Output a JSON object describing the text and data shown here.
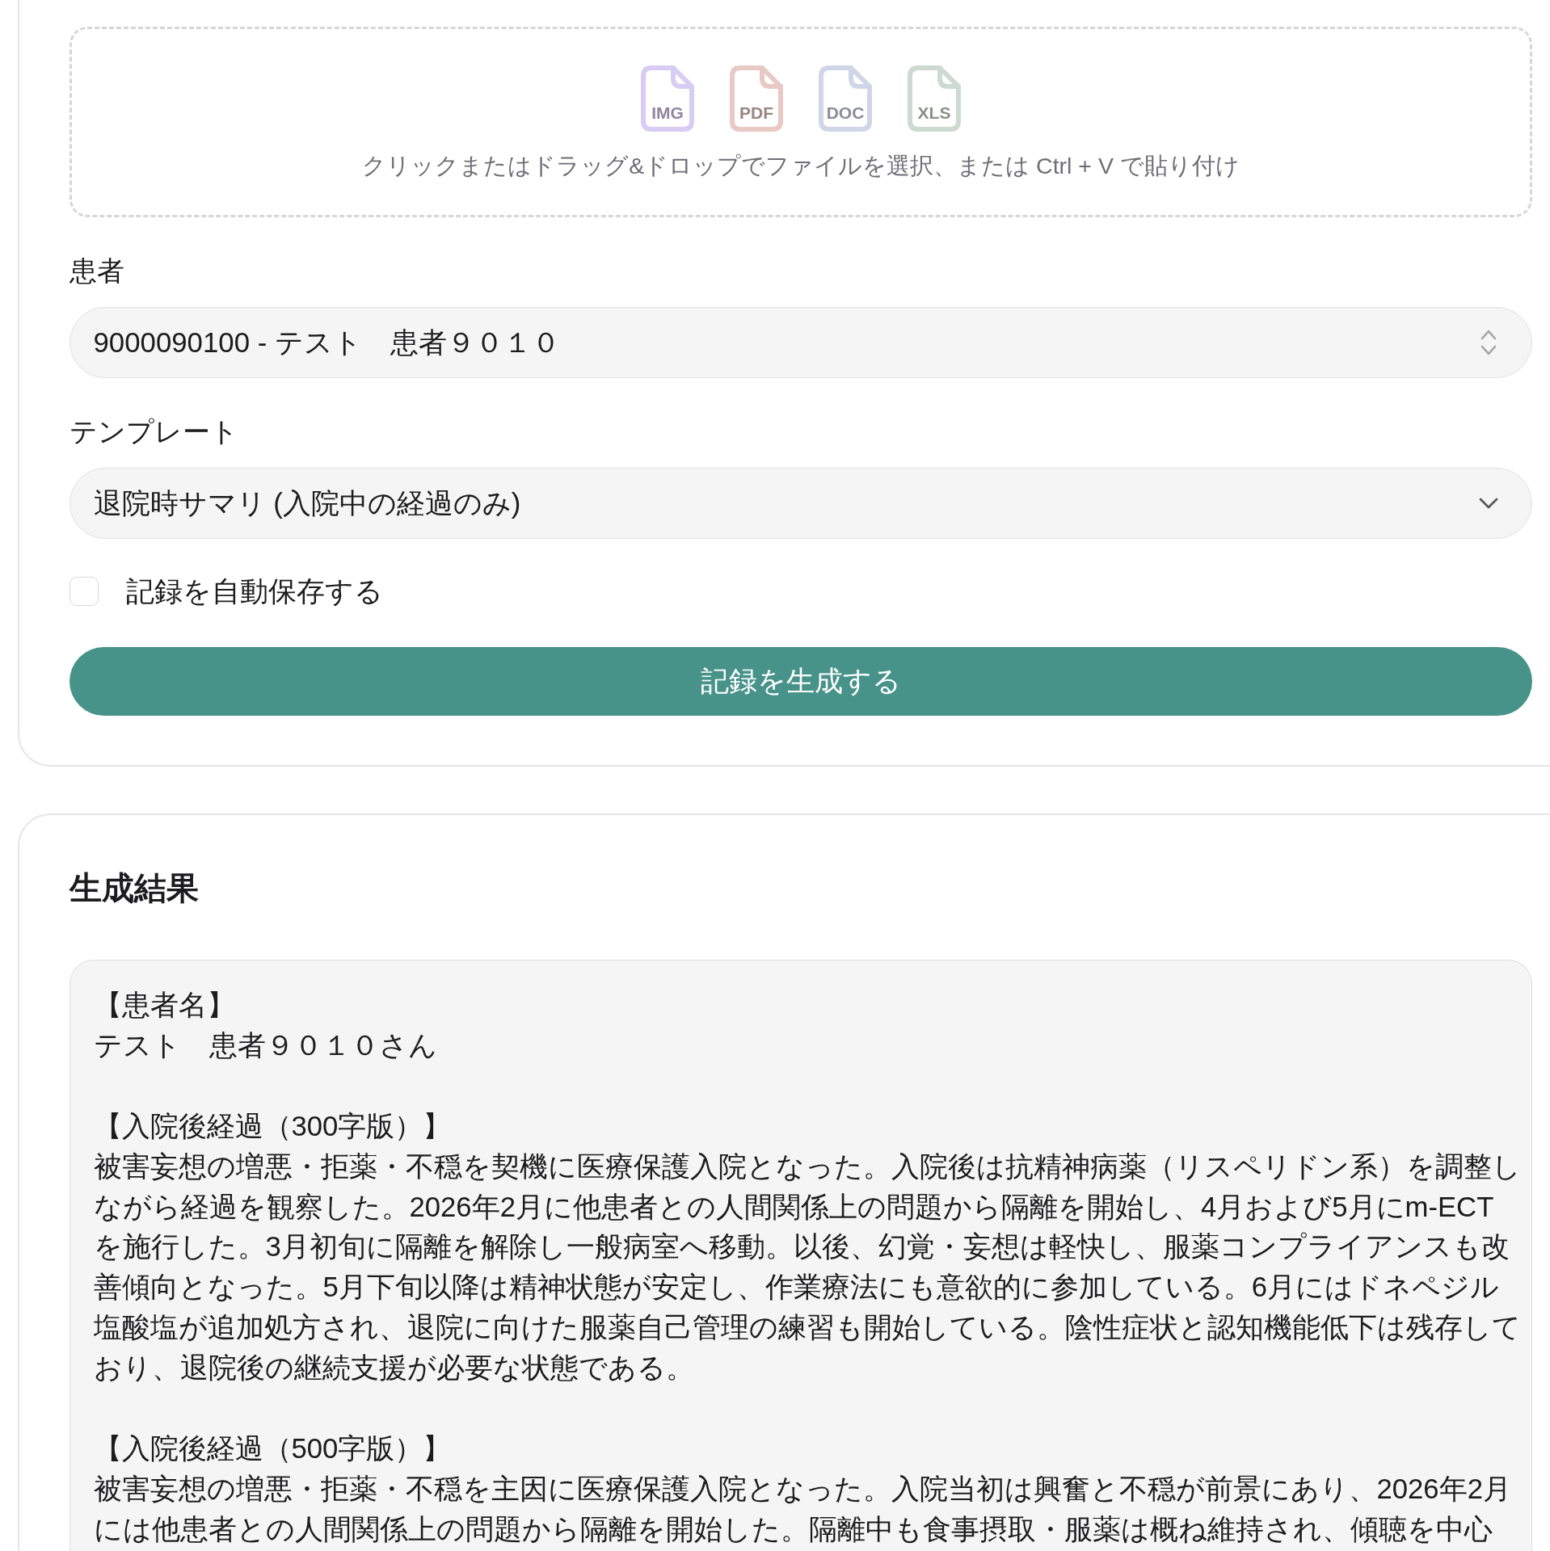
{
  "upload": {
    "file_types": [
      {
        "label": "IMG",
        "color": "#d8ccf3"
      },
      {
        "label": "PDF",
        "color": "#e9c9c4"
      },
      {
        "label": "DOC",
        "color": "#cfd6e7"
      },
      {
        "label": "XLS",
        "color": "#cddad0"
      }
    ],
    "hint": "クリックまたはドラッグ&ドロップでファイルを選択、または Ctrl + V で貼り付け"
  },
  "fields": [
    {
      "kind": "combobox",
      "label": "患者",
      "value": "9000090100 - テスト　患者９０１０"
    },
    {
      "kind": "dropdown",
      "label": "テンプレート",
      "value": "退院時サマリ (入院中の経過のみ)"
    }
  ],
  "autosave": {
    "label": "記録を自動保存する",
    "checked": false
  },
  "generate_button": "記録を生成する",
  "result": {
    "title": "生成結果",
    "sections": [
      {
        "heading": "【患者名】",
        "lines": [
          "テスト　患者９０１０さん"
        ]
      },
      {
        "heading": "【入院後経過（300字版）】",
        "lines": [
          "被害妄想の増悪・拒薬・不穏を契機に医療保護入院となった。入院後は抗精神病薬（リスペリドン系）を調整し",
          "ながら経過を観察した。2026年2月に他患者との人間関係上の問題から隔離を開始し、4月および5月にm-ECT",
          "を施行した。3月初旬に隔離を解除し一般病室へ移動。以後、幻覚・妄想は軽快し、服薬コンプライアンスも改",
          "善傾向となった。5月下旬以降は精神状態が安定し、作業療法にも意欲的に参加している。6月にはドネペジル",
          "塩酸塩が追加処方され、退院に向けた服薬自己管理の練習も開始している。陰性症状と認知機能低下は残存して",
          "おり、退院後の継続支援が必要な状態である。"
        ]
      },
      {
        "heading": "【入院後経過（500字版）】",
        "lines": [
          "被害妄想の増悪・拒薬・不穏を主因に医療保護入院となった。入院当初は興奮と不穏が前景にあり、2026年2月",
          "には他患者との人間関係上の問題から隔離を開始した。隔離中も食事摂取・服薬は概ね維持され、傾聴を中心"
        ]
      }
    ]
  }
}
